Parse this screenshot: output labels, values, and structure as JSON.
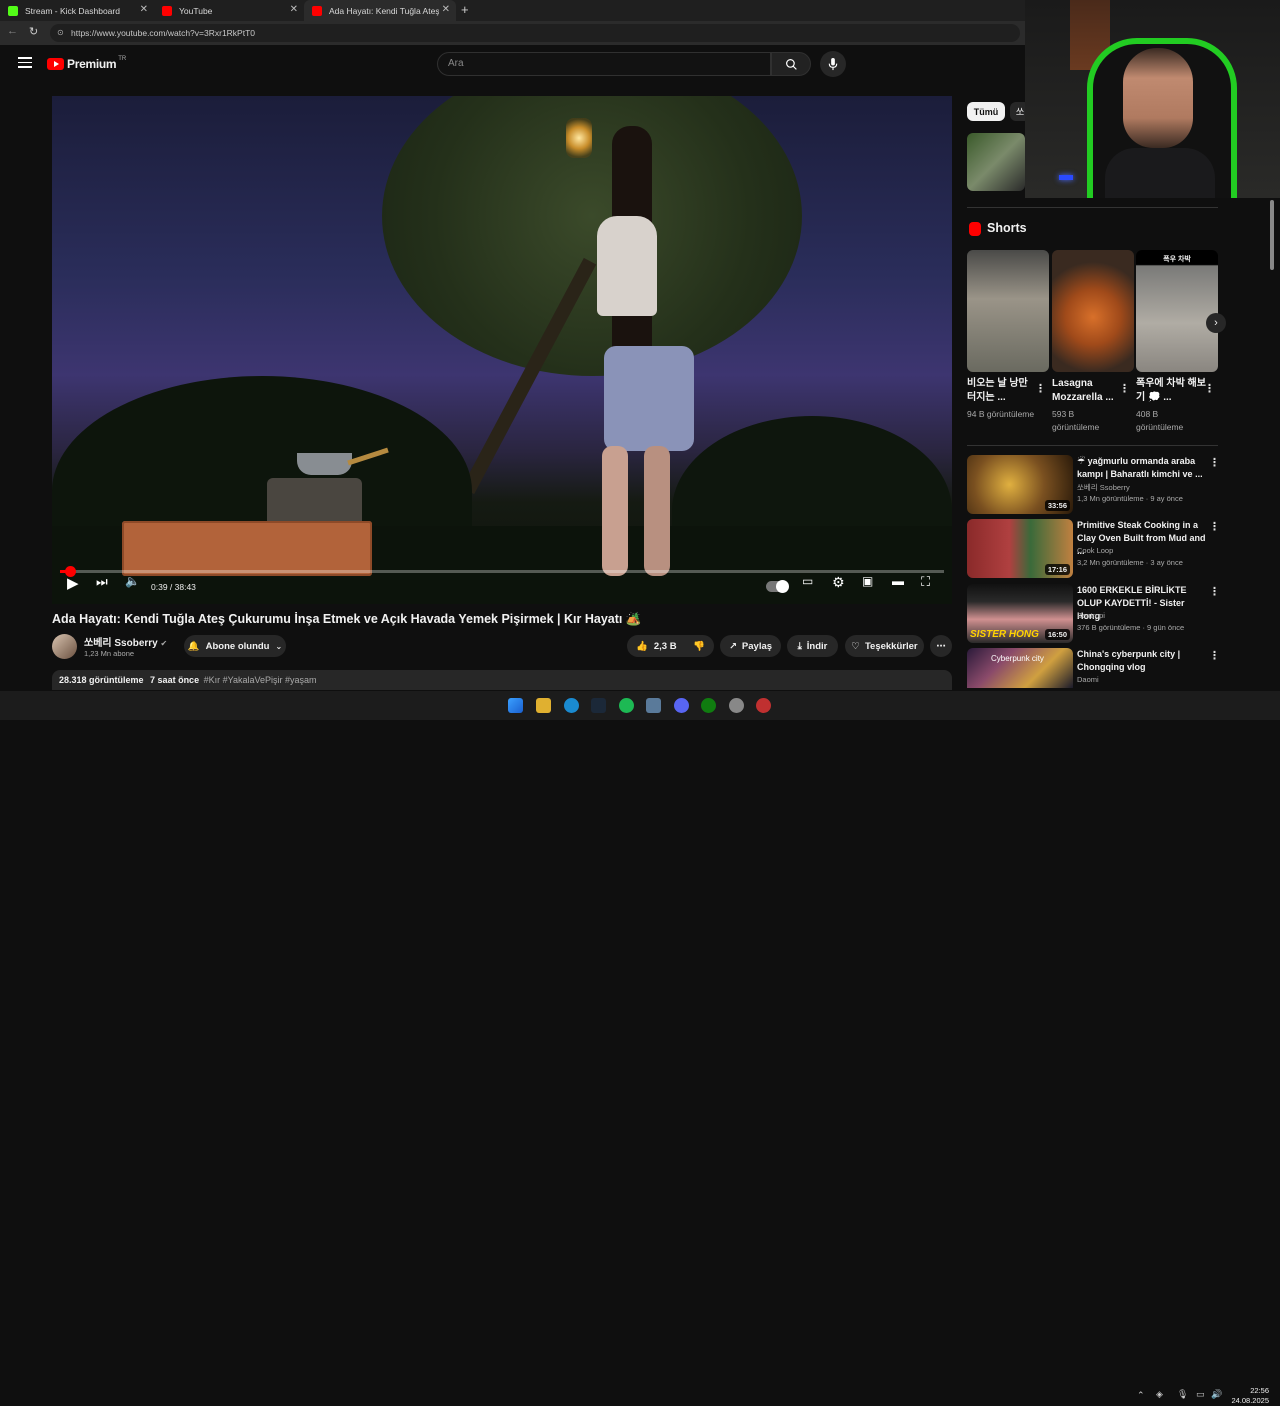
{
  "browser": {
    "tabs": [
      {
        "label": "Stream - Kick Dashboard",
        "icon": "kick-icon"
      },
      {
        "label": "YouTube",
        "icon": "youtube-icon"
      },
      {
        "label": "Ada Hayatı: Kendi Tuğla Ateş Çu…",
        "icon": "youtube-icon"
      }
    ],
    "url": "https://www.youtube.com/watch?v=3Rxr1RkPtT0"
  },
  "header": {
    "logo_text": "Premium",
    "logo_badge": "TR",
    "search_placeholder": "Ara"
  },
  "player": {
    "time": "0:39 / 38:43",
    "progress": 0.017
  },
  "video": {
    "title": "Ada Hayatı: Kendi Tuğla Ateş Çukurumu İnşa Etmek ve Açık Havada Yemek Pişirmek | Kır Hayatı 🏕️",
    "channel": "쏘베리 Ssoberry",
    "subscribers": "1,23 Mn abone",
    "subscribe_label": "Abone olundu",
    "likes": "2,3 B",
    "share_label": "Paylaş",
    "download_label": "İndir",
    "thanks_label": "Teşekkürler",
    "views": "28.318 görüntüleme",
    "age": "7 saat önce",
    "hashtags": "#Kır #YakalaVePişir #yaşam"
  },
  "sidebar": {
    "chip_all": "Tümü",
    "chip_second": "쏘",
    "shorts_heading": "Shorts",
    "shorts": [
      {
        "title": "비오는 날 낭만 터지는 ...",
        "views": "94 B görüntüleme"
      },
      {
        "title": "Lasagna Mozzarella ...",
        "views": "593 B görüntüleme",
        "overlay": ""
      },
      {
        "title": "폭우에 차박 해보기 💭 ...",
        "views": "408 B görüntüleme",
        "overlay": "폭우 차박"
      }
    ],
    "recommended": [
      {
        "title": "☔ yağmurlu ormanda araba kampı | Baharatlı kimchi ve ...",
        "channel": "쏘베리 Ssoberry",
        "meta": "1,3 Mn görüntüleme · 9 ay önce",
        "duration": "33:56"
      },
      {
        "title": "Primitive Steak Cooking in a Clay Oven Built from Mud and ...",
        "channel": "Cook Loop",
        "meta": "3,2 Mn görüntüleme · 3 ay önce",
        "duration": "17:16"
      },
      {
        "title": "1600 ERKEKLE BİRLİKTE OLUP KAYDETTİ! - Sister Hong",
        "channel": "Bentropi",
        "meta": "376 B görüntüleme · 9 gün önce",
        "duration": "16:50",
        "thumb_text": "SISTER HONG"
      },
      {
        "title": "China's cyberpunk city | Chongqing vlog",
        "channel": "Daomi",
        "meta": "",
        "duration": "",
        "thumb_text": "Cyberpunk city"
      }
    ]
  },
  "taskbar": {
    "time": "22:56",
    "date": "24.08.2025"
  }
}
